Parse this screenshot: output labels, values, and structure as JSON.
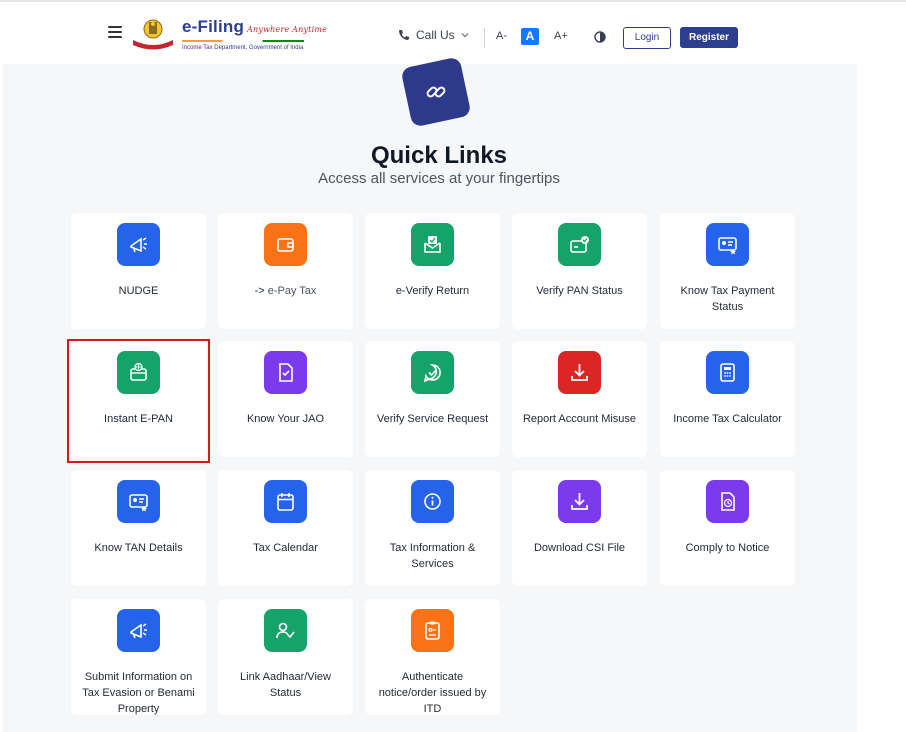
{
  "header": {
    "brand_title": "e-Filing",
    "brand_tagline": "Anywhere Anytime",
    "brand_subtitle": "Income Tax Department, Government of India",
    "call_us": "Call Us",
    "font_decrease": "A-",
    "font_default": "A",
    "font_increase": "A+",
    "login": "Login",
    "register": "Register"
  },
  "main": {
    "title": "Quick Links",
    "subtitle": "Access all services at your fingertips"
  },
  "cards": [
    {
      "label": "NUDGE",
      "icon": "megaphone-icon",
      "color": "#2563eb"
    },
    {
      "prefix": "-> ",
      "label": "e-Pay Tax",
      "icon": "wallet-icon",
      "color": "#f97316"
    },
    {
      "label": "e-Verify Return",
      "icon": "verify-envelope-icon",
      "color": "#16a36a"
    },
    {
      "label": "Verify PAN Status",
      "icon": "card-check-icon",
      "color": "#16a36a"
    },
    {
      "label": "Know Tax Payment Status",
      "icon": "id-card-icon",
      "color": "#2563eb"
    },
    {
      "label": "Instant E-PAN",
      "icon": "globe-card-icon",
      "color": "#16a36a"
    },
    {
      "label": "Know Your JAO",
      "icon": "document-check-icon",
      "color": "#7c3aed"
    },
    {
      "label": "Verify Service Request",
      "icon": "chat-check-icon",
      "color": "#16a36a"
    },
    {
      "label": "Report Account Misuse",
      "icon": "download-icon",
      "color": "#dc2626"
    },
    {
      "label": "Income Tax Calculator",
      "icon": "calculator-icon",
      "color": "#2563eb"
    },
    {
      "label": "Know TAN Details",
      "icon": "id-card-icon",
      "color": "#2563eb"
    },
    {
      "label": "Tax Calendar",
      "icon": "calendar-icon",
      "color": "#2563eb"
    },
    {
      "label": "Tax Information & Services",
      "icon": "info-icon",
      "color": "#2563eb"
    },
    {
      "label": "Download CSI File",
      "icon": "download-icon",
      "color": "#7c3aed"
    },
    {
      "label": "Comply to Notice",
      "icon": "notice-clock-icon",
      "color": "#7c3aed"
    },
    {
      "label": "Submit Information on Tax Evasion or Benami Property",
      "icon": "megaphone-icon",
      "color": "#2563eb"
    },
    {
      "label": "Link Aadhaar/View Status",
      "icon": "user-check-icon",
      "color": "#16a36a"
    },
    {
      "label": "Authenticate notice/order issued by ITD",
      "icon": "clipboard-icon",
      "color": "#f97316"
    }
  ]
}
